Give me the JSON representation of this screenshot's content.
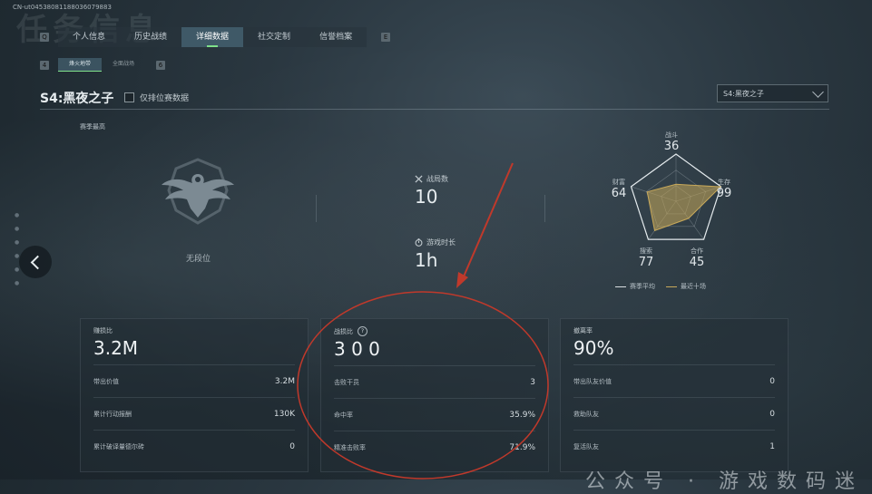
{
  "header": {
    "uid": "CN-ut04538081188036079883",
    "big_title": "任务信息"
  },
  "tabs": {
    "left_key": "Q",
    "right_key": "E",
    "items": [
      {
        "label": "个人信息",
        "active": false
      },
      {
        "label": "历史战绩",
        "active": false
      },
      {
        "label": "详细数据",
        "active": true
      },
      {
        "label": "社交定制",
        "active": false
      },
      {
        "label": "信誉档案",
        "active": false
      }
    ]
  },
  "subtabs": {
    "left_key": "4",
    "right_key": "6",
    "items": [
      {
        "label": "烽火地带",
        "active": true
      },
      {
        "label": "全面战场",
        "active": false
      }
    ]
  },
  "season": {
    "title": "S4:黑夜之子",
    "rank_only_label": "仅排位赛数据",
    "select_value": "S4:黑夜之子"
  },
  "summary": {
    "season_best_label": "赛季最高",
    "rank_name": "无段位",
    "matches_label": "战局数",
    "matches_value": "10",
    "playtime_label": "游戏时长",
    "playtime_value": "1h"
  },
  "radar": {
    "axes": [
      {
        "label": "战斗",
        "value": 36
      },
      {
        "label": "生存",
        "value": 99
      },
      {
        "label": "合作",
        "value": 45
      },
      {
        "label": "搜索",
        "value": 77
      },
      {
        "label": "财富",
        "value": 64
      }
    ],
    "legend": [
      {
        "label": "赛季平均",
        "color": "#d9dee1"
      },
      {
        "label": "最近十场",
        "color": "#c8a95a"
      }
    ]
  },
  "cards": [
    {
      "label": "赚损比",
      "value": "3.2M",
      "rows": [
        {
          "label": "带出价值",
          "value": "3.2M"
        },
        {
          "label": "累计行动报酬",
          "value": "130K"
        },
        {
          "label": "累计破译量德尔砖",
          "value": "0"
        }
      ]
    },
    {
      "label": "战损比",
      "value": "3 0 0",
      "help": "?",
      "rows": [
        {
          "label": "击败干员",
          "value": "3"
        },
        {
          "label": "命中率",
          "value": "35.9%"
        },
        {
          "label": "精准击败率",
          "value": "71.9%"
        }
      ]
    },
    {
      "label": "撤离率",
      "value": "90%",
      "rows": [
        {
          "label": "带出队友价值",
          "value": "0"
        },
        {
          "label": "救助队友",
          "value": "0"
        },
        {
          "label": "复活队友",
          "value": "1"
        }
      ]
    }
  ],
  "watermark": "公众号 · 游戏数码迷",
  "colors": {
    "accent_green": "#7fe08a",
    "annotation_red": "#c0392b",
    "radar_fill": "#c8a95a"
  }
}
